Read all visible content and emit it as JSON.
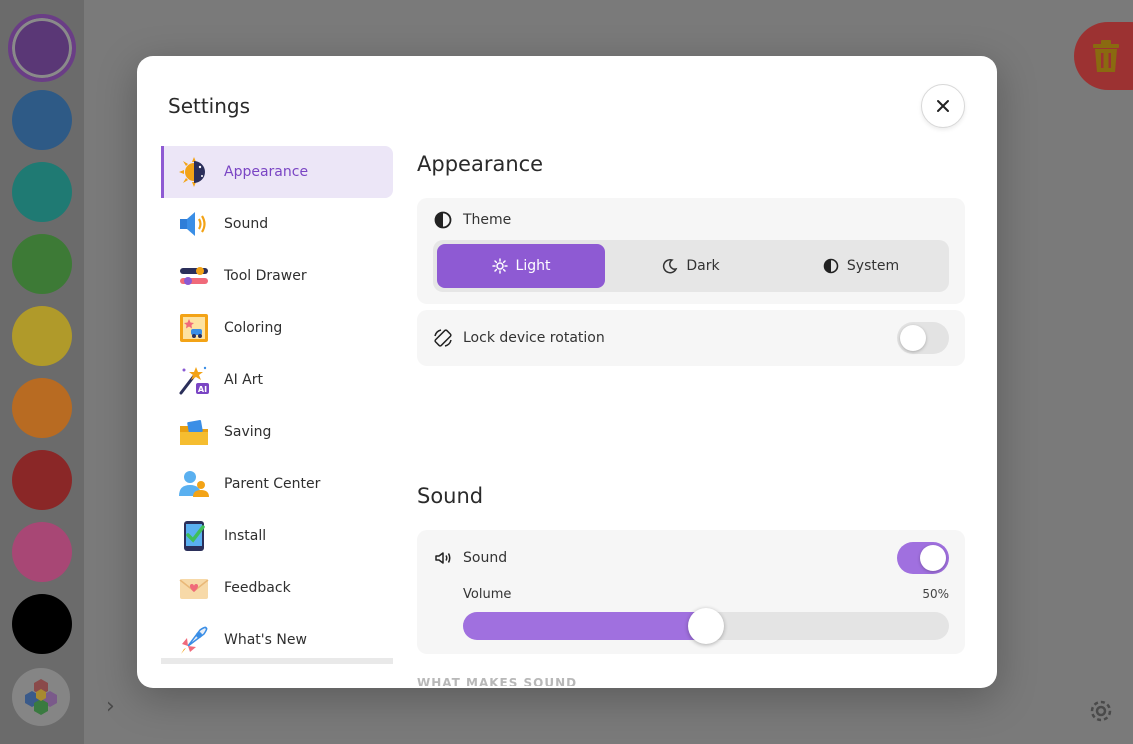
{
  "palette": {
    "colors": [
      "#5a3776",
      "#2e5a86",
      "#1f7a73",
      "#3d7a36",
      "#b09a2a",
      "#b86b22",
      "#8a2727",
      "#a84775",
      "#000000"
    ]
  },
  "modal": {
    "title": "Settings",
    "close_icon": "close-icon"
  },
  "nav": {
    "accent": "#8e5ad3",
    "items": [
      {
        "label": "Appearance",
        "icon": "sun-moon-icon"
      },
      {
        "label": "Sound",
        "icon": "speaker-icon"
      },
      {
        "label": "Tool Drawer",
        "icon": "sliders-icon"
      },
      {
        "label": "Coloring",
        "icon": "coloring-page-icon"
      },
      {
        "label": "AI Art",
        "icon": "magic-wand-icon"
      },
      {
        "label": "Saving",
        "icon": "folder-icon"
      },
      {
        "label": "Parent Center",
        "icon": "people-icon"
      },
      {
        "label": "Install",
        "icon": "phone-check-icon"
      },
      {
        "label": "Feedback",
        "icon": "envelope-heart-icon"
      },
      {
        "label": "What's New",
        "icon": "rocket-icon"
      }
    ]
  },
  "appearance": {
    "title": "Appearance",
    "theme_label": "Theme",
    "theme_options": [
      "Light",
      "Dark",
      "System"
    ],
    "theme_selected": "Light",
    "lock_label": "Lock device rotation",
    "lock_on": false
  },
  "sound": {
    "title": "Sound",
    "sound_label": "Sound",
    "sound_on": true,
    "volume_label": "Volume",
    "volume_value": "50%",
    "volume_fraction": 0.5,
    "what_makes_sound": "WHAT MAKES SOUND"
  }
}
